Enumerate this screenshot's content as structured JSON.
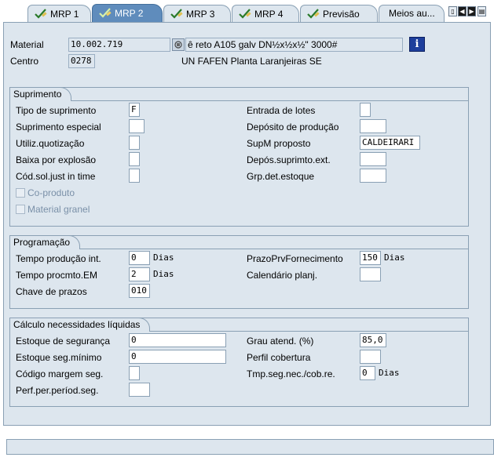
{
  "tabs": [
    {
      "label": "MRP 1",
      "icon": "check-pencil-icon",
      "active": false
    },
    {
      "label": "MRP 2",
      "icon": "check-pencil-icon",
      "active": true
    },
    {
      "label": "MRP 3",
      "icon": "check-pencil-icon",
      "active": false
    },
    {
      "label": "MRP 4",
      "icon": "check-pencil-icon",
      "active": false
    },
    {
      "label": "Previsão",
      "icon": "check-pencil-icon",
      "active": false
    },
    {
      "label": "Meios au...",
      "icon": "",
      "active": false
    }
  ],
  "nav": {
    "first": "▯",
    "prev": "◀",
    "next": "▶",
    "list": "▤"
  },
  "header": {
    "material_label": "Material",
    "material_value": "10.002.719",
    "material_desc": "ê reto A105 galv DN½x½x½\" 3000#",
    "centro_label": "Centro",
    "centro_value": "0278",
    "centro_desc": "UN FAFEN Planta Laranjeiras SE",
    "info_icon": "i"
  },
  "suprimento": {
    "title": "Suprimento",
    "tipo_label": "Tipo de suprimento",
    "tipo_value": "F",
    "especial_label": "Suprimento especial",
    "especial_value": "",
    "quot_label": "Utiliz.quotização",
    "quot_value": "",
    "baixa_label": "Baixa por explosão",
    "baixa_value": "",
    "cod_label": "Cód.sol.just in time",
    "cod_value": "",
    "coproduto_label": "Co-produto",
    "granel_label": "Material granel",
    "lotes_label": "Entrada de lotes",
    "lotes_value": "",
    "deposito_label": "Depósito de produção",
    "deposito_value": "",
    "supm_label": "SupM proposto",
    "supm_value": "CALDEIRARI",
    "depos_ext_label": "Depós.suprimto.ext.",
    "depos_ext_value": "",
    "grp_label": "Grp.det.estoque",
    "grp_value": ""
  },
  "programacao": {
    "title": "Programação",
    "tempo_prod_label": "Tempo produção int.",
    "tempo_prod_value": "0",
    "tempo_prod_unit": "Dias",
    "tempo_em_label": "Tempo procmto.EM",
    "tempo_em_value": "2",
    "tempo_em_unit": "Dias",
    "chave_label": "Chave de prazos",
    "chave_value": "010",
    "prazo_label": "PrazoPrvFornecimento",
    "prazo_value": "150",
    "prazo_unit": "Dias",
    "cal_label": "Calendário planj.",
    "cal_value": ""
  },
  "calculo": {
    "title": "Cálculo necessidades líquidas",
    "est_seg_label": "Estoque de segurança",
    "est_seg_value": "0",
    "est_min_label": "Estoque seg.mínimo",
    "est_min_value": "0",
    "cod_margem_label": "Código margem seg.",
    "cod_margem_value": "",
    "perf_label": "Perf.per.períod.seg.",
    "perf_value": "",
    "grau_label": "Grau atend. (%)",
    "grau_value": "85,0",
    "perfil_label": "Perfil cobertura",
    "perfil_value": "",
    "tmp_label": "Tmp.seg.nec./cob.re.",
    "tmp_value": "0",
    "tmp_unit": "Dias"
  },
  "status": {
    "text": ""
  }
}
